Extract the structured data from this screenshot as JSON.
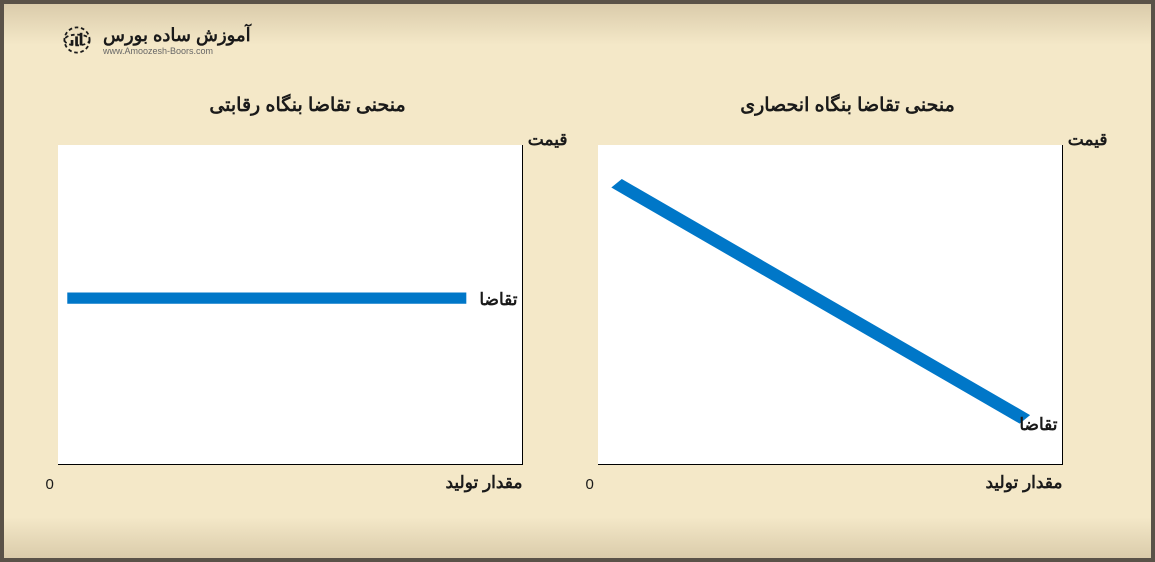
{
  "logo": {
    "title": "آموزش ساده بورس",
    "subtitle": "www.Amoozesh-Boors.com"
  },
  "charts": {
    "right": {
      "title": "منحنی تقاضا بنگاه انحصاری",
      "ylabel": "قیمت",
      "xlabel": "مقدار تولید",
      "origin": "0",
      "line_label": "تقاضا"
    },
    "left": {
      "title": "منحنی تقاضا بنگاه رقابتی",
      "ylabel": "قیمت",
      "xlabel": "مقدار تولید",
      "origin": "0",
      "line_label": "تقاضا"
    }
  },
  "chart_data": [
    {
      "type": "line",
      "title": "منحنی تقاضا بنگاه انحصاری",
      "xlabel": "مقدار تولید",
      "ylabel": "قیمت",
      "series": [
        {
          "name": "تقاضا",
          "x": [
            0,
            100
          ],
          "y": [
            90,
            10
          ]
        }
      ],
      "xlim": [
        0,
        100
      ],
      "ylim": [
        0,
        100
      ],
      "note": "downward-sloping demand curve (monopoly firm)"
    },
    {
      "type": "line",
      "title": "منحنی تقاضا بنگاه رقابتی",
      "xlabel": "مقدار تولید",
      "ylabel": "قیمت",
      "series": [
        {
          "name": "تقاضا",
          "x": [
            0,
            100
          ],
          "y": [
            50,
            50
          ]
        }
      ],
      "xlim": [
        0,
        100
      ],
      "ylim": [
        0,
        100
      ],
      "note": "horizontal (perfectly elastic) demand curve (competitive firm)"
    }
  ],
  "colors": {
    "line": "#0077c8",
    "bg": "#f4e8c8",
    "border": "#5a5248"
  }
}
